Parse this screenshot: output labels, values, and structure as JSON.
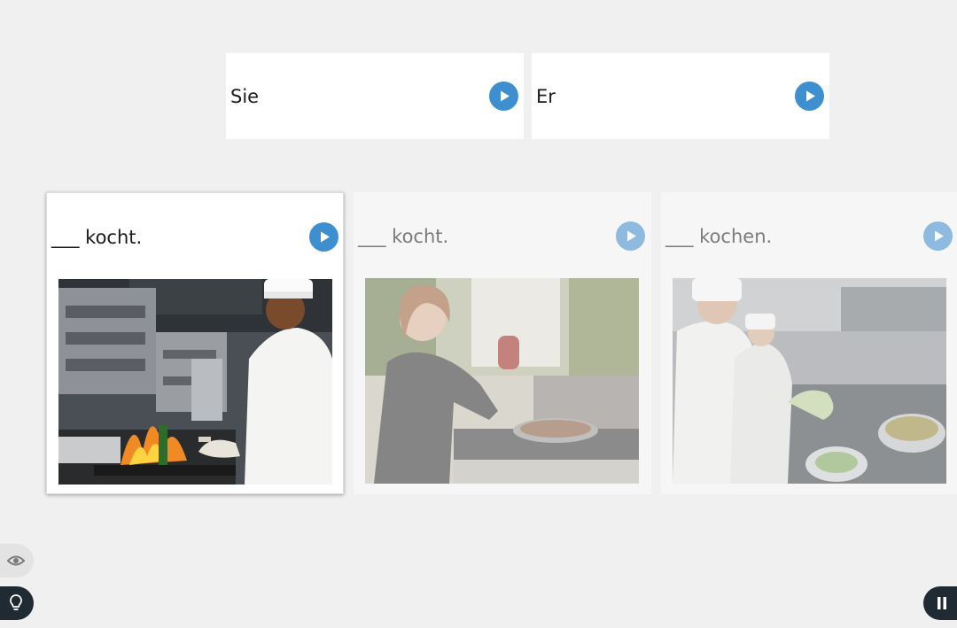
{
  "answers": [
    {
      "word": "Sie"
    },
    {
      "word": "Er"
    }
  ],
  "cards": [
    {
      "sentence": "___ kocht.",
      "state": "active",
      "photo": "man-chef-flambe-photo"
    },
    {
      "sentence": "___ kocht.",
      "state": "dim",
      "photo": "woman-cooking-pan-photo"
    },
    {
      "sentence": "___ kochen.",
      "state": "dim",
      "photo": "chefs-kitchen-photo"
    }
  ],
  "controls": {
    "visibility_icon": "eye-icon",
    "hint_icon": "lightbulb-icon",
    "pause_icon": "pause-icon"
  },
  "colors": {
    "accent": "#3d8fd0",
    "background": "#f0f0f0",
    "control_dark": "#1f2a33"
  }
}
